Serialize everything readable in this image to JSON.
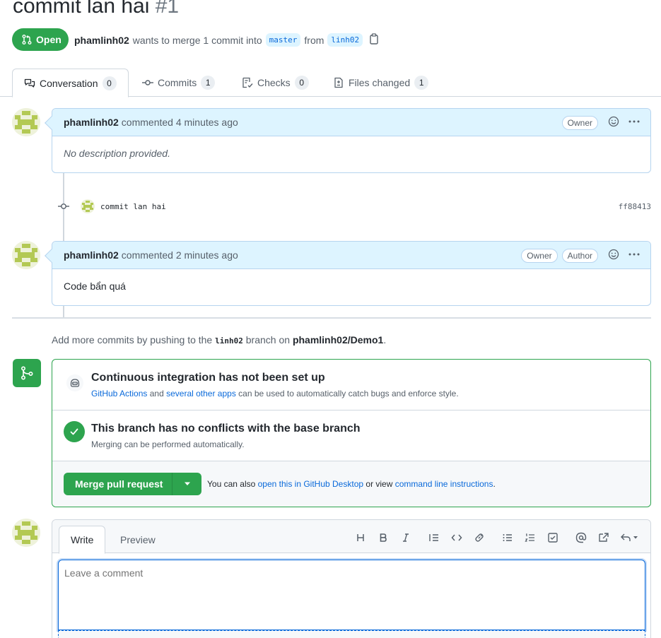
{
  "pr": {
    "title": "commit lan hai",
    "number": "#1",
    "state": "Open",
    "author": "phamlinh02",
    "merge_text": "wants to merge 1 commit into",
    "base_branch": "master",
    "from_text": "from",
    "head_branch": "linh02"
  },
  "tabs": [
    {
      "label": "Conversation",
      "count": "0"
    },
    {
      "label": "Commits",
      "count": "1"
    },
    {
      "label": "Checks",
      "count": "0"
    },
    {
      "label": "Files changed",
      "count": "1"
    }
  ],
  "comments": [
    {
      "author": "phamlinh02",
      "action": "commented 4 minutes ago",
      "roles": [
        "Owner"
      ],
      "body": "No description provided."
    },
    {
      "author": "phamlinh02",
      "action": "commented 2 minutes ago",
      "roles": [
        "Owner",
        "Author"
      ],
      "body": "Code bẩn quá"
    }
  ],
  "commit": {
    "message": "commit lan hai",
    "sha": "ff88413"
  },
  "push_hint": {
    "prefix": "Add more commits by pushing to the",
    "branch": "linh02",
    "middle": "branch on",
    "repo": "phamlinh02/Demo1",
    "suffix": "."
  },
  "merge_box": {
    "ci_title": "Continuous integration has not been set up",
    "ci_link1": "GitHub Actions",
    "ci_and": "and",
    "ci_link2": "several other apps",
    "ci_rest": "can be used to automatically catch bugs and enforce style.",
    "conflict_title": "This branch has no conflicts with the base branch",
    "conflict_sub": "Merging can be performed automatically.",
    "merge_button": "Merge pull request",
    "footer_prefix": "You can also",
    "footer_link1": "open this in GitHub Desktop",
    "footer_mid": "or view",
    "footer_link2": "command line instructions",
    "footer_suffix": "."
  },
  "composer": {
    "tab_write": "Write",
    "tab_preview": "Preview",
    "placeholder": "Leave a comment",
    "toolbar_icons": [
      "heading-icon",
      "bold-icon",
      "italic-icon",
      "quote-icon",
      "code-icon",
      "link-icon",
      "unordered-list-icon",
      "ordered-list-icon",
      "task-list-icon",
      "mention-icon",
      "cross-reference-icon",
      "reply-icon"
    ]
  },
  "colors": {
    "green": "#2da44e",
    "blue_link": "#0969da",
    "header_blue": "#ddf4ff"
  }
}
